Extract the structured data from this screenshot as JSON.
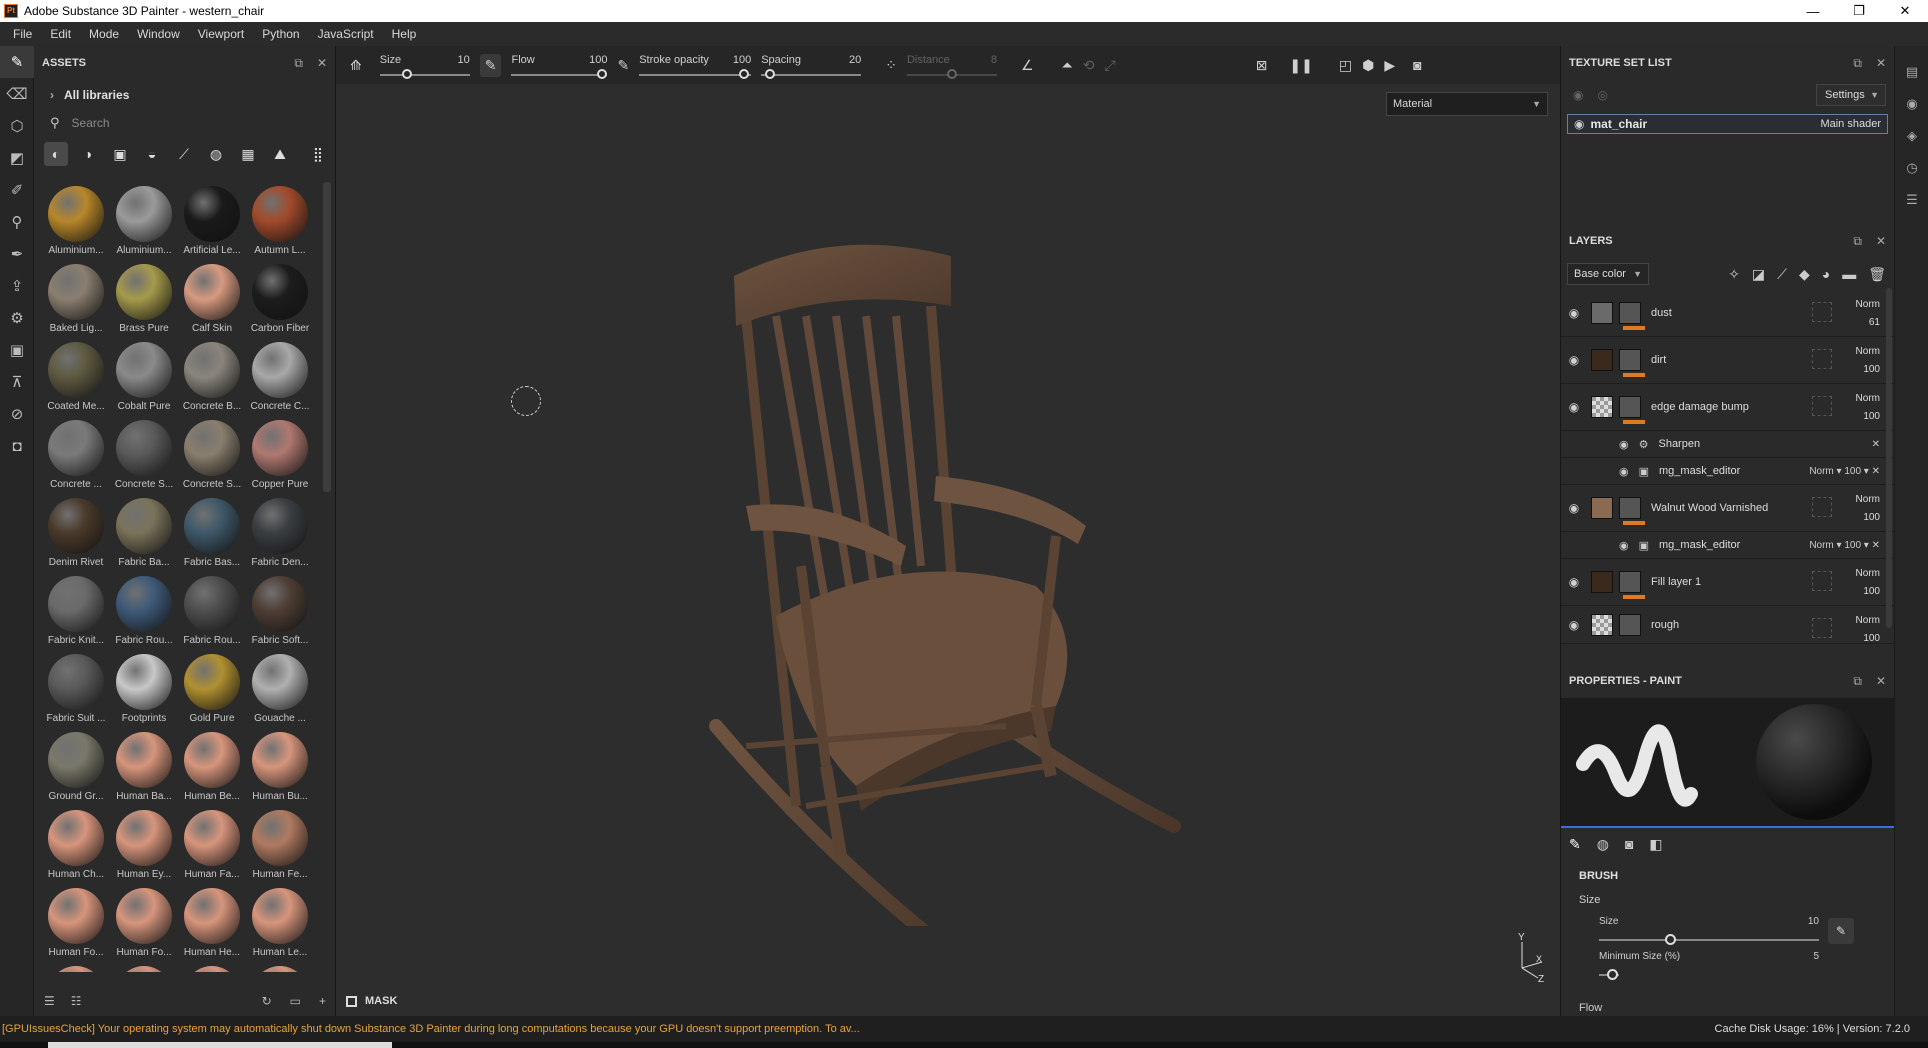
{
  "window": {
    "title": "Adobe Substance 3D Painter - western_chair",
    "app_icon": "Pt"
  },
  "menu": [
    "File",
    "Edit",
    "Mode",
    "Window",
    "Viewport",
    "Python",
    "JavaScript",
    "Help"
  ],
  "assets": {
    "title": "ASSETS",
    "library": "All libraries",
    "search_placeholder": "Search",
    "materials": [
      {
        "label": "Aluminium...",
        "color": "#b8872a"
      },
      {
        "label": "Aluminium...",
        "color": "#9a9a9a"
      },
      {
        "label": "Artificial Le...",
        "color": "#1a1a1a"
      },
      {
        "label": "Autumn L...",
        "color": "#a24a2a"
      },
      {
        "label": "Baked Lig...",
        "color": "#8a7f70"
      },
      {
        "label": "Brass Pure",
        "color": "#a59a4a"
      },
      {
        "label": "Calf Skin",
        "color": "#d79a80"
      },
      {
        "label": "Carbon Fiber",
        "color": "#1c1c1c"
      },
      {
        "label": "Coated Me...",
        "color": "#5e5a40"
      },
      {
        "label": "Cobalt Pure",
        "color": "#8a8a8a"
      },
      {
        "label": "Concrete B...",
        "color": "#8a857c"
      },
      {
        "label": "Concrete C...",
        "color": "#a8a8a8"
      },
      {
        "label": "Concrete ...",
        "color": "#7a7a7a"
      },
      {
        "label": "Concrete S...",
        "color": "#5a5a5a"
      },
      {
        "label": "Concrete S...",
        "color": "#8a7e6e"
      },
      {
        "label": "Copper Pure",
        "color": "#b07870"
      },
      {
        "label": "Denim Rivet",
        "color": "#4a3a2a"
      },
      {
        "label": "Fabric Ba...",
        "color": "#7a735a"
      },
      {
        "label": "Fabric Bas...",
        "color": "#3e5868"
      },
      {
        "label": "Fabric Den...",
        "color": "#3a3e42"
      },
      {
        "label": "Fabric Knit...",
        "color": "#6a6a6a"
      },
      {
        "label": "Fabric Rou...",
        "color": "#3e5a78"
      },
      {
        "label": "Fabric Rou...",
        "color": "#4e4e4e"
      },
      {
        "label": "Fabric Soft...",
        "color": "#4e3e34"
      },
      {
        "label": "Fabric Suit ...",
        "color": "#5a5a5a"
      },
      {
        "label": "Footprints",
        "color": "#c8c8c8"
      },
      {
        "label": "Gold Pure",
        "color": "#b09030"
      },
      {
        "label": "Gouache ...",
        "color": "#b0b0b0"
      },
      {
        "label": "Ground Gr...",
        "color": "#7a786a"
      },
      {
        "label": "Human Ba...",
        "color": "#d7957c"
      },
      {
        "label": "Human Be...",
        "color": "#d7957c"
      },
      {
        "label": "Human Bu...",
        "color": "#d7957c"
      },
      {
        "label": "Human Ch...",
        "color": "#d7957c"
      },
      {
        "label": "Human Ey...",
        "color": "#d7957c"
      },
      {
        "label": "Human Fa...",
        "color": "#d7957c"
      },
      {
        "label": "Human Fe...",
        "color": "#b07a60"
      },
      {
        "label": "Human Fo...",
        "color": "#d7957c"
      },
      {
        "label": "Human Fo...",
        "color": "#d7957c"
      },
      {
        "label": "Human He...",
        "color": "#d7957c"
      },
      {
        "label": "Human Le...",
        "color": "#d7957c"
      },
      {
        "label": "",
        "color": "#d7957c"
      },
      {
        "label": "",
        "color": "#d7957c"
      },
      {
        "label": "",
        "color": "#d7957c"
      },
      {
        "label": "",
        "color": "#d7957c"
      }
    ]
  },
  "viewport_toolbar": {
    "size_label": "Size",
    "size_value": "10",
    "flow_label": "Flow",
    "flow_value": "100",
    "stroke_label": "Stroke opacity",
    "stroke_value": "100",
    "spacing_label": "Spacing",
    "spacing_value": "20",
    "distance_label": "Distance",
    "distance_value": "8"
  },
  "viewport": {
    "display_mode": "Material",
    "mask_label": "MASK",
    "axis_y": "Y",
    "axis_x": "X",
    "axis_z": "Z"
  },
  "texture_set_list": {
    "title": "TEXTURE SET LIST",
    "settings": "Settings",
    "material": "mat_chair",
    "shader": "Main shader"
  },
  "layers": {
    "title": "LAYERS",
    "channel": "Base color",
    "items": [
      {
        "name": "dust",
        "blend": "Norm",
        "opacity": "61",
        "thumb": "#6a6a6a"
      },
      {
        "name": "dirt",
        "blend": "Norm",
        "opacity": "100",
        "thumb": "#3a2a1e"
      },
      {
        "name": "edge damage bump",
        "blend": "Norm",
        "opacity": "100",
        "thumb": "#c8c8c8"
      },
      {
        "name": "Walnut Wood Varnished",
        "blend": "Norm",
        "opacity": "100",
        "thumb": "#8a6a50"
      },
      {
        "name": "Fill layer 1",
        "blend": "Norm",
        "opacity": "100",
        "thumb": "#3a2a1e"
      },
      {
        "name": "rough",
        "blend": "Norm",
        "opacity": "100",
        "thumb": "#c8c8c8"
      }
    ],
    "sharpen": "Sharpen",
    "mask_editor": "mg_mask_editor",
    "mask_blend": "Norm",
    "mask_opacity": "100",
    "mask_editor2": "mg_mask_editor",
    "mask_blend2": "Norm",
    "mask_opacity2": "100"
  },
  "properties": {
    "title": "PROPERTIES - PAINT",
    "brush_heading": "BRUSH",
    "size_section": "Size",
    "size_label": "Size",
    "size_value": "10",
    "min_size_label": "Minimum Size (%)",
    "min_size_value": "5",
    "flow_section": "Flow"
  },
  "status": {
    "warning": "[GPUIssuesCheck] Your operating system may automatically shut down Substance 3D Painter during long computations because your GPU doesn't support preemption. To av...",
    "cache": "Cache Disk Usage:   16% | Version: 7.2.0"
  },
  "colors": {
    "accent": "#e07a20",
    "selection": "#3b6fd0",
    "warning": "#e8a33c"
  }
}
